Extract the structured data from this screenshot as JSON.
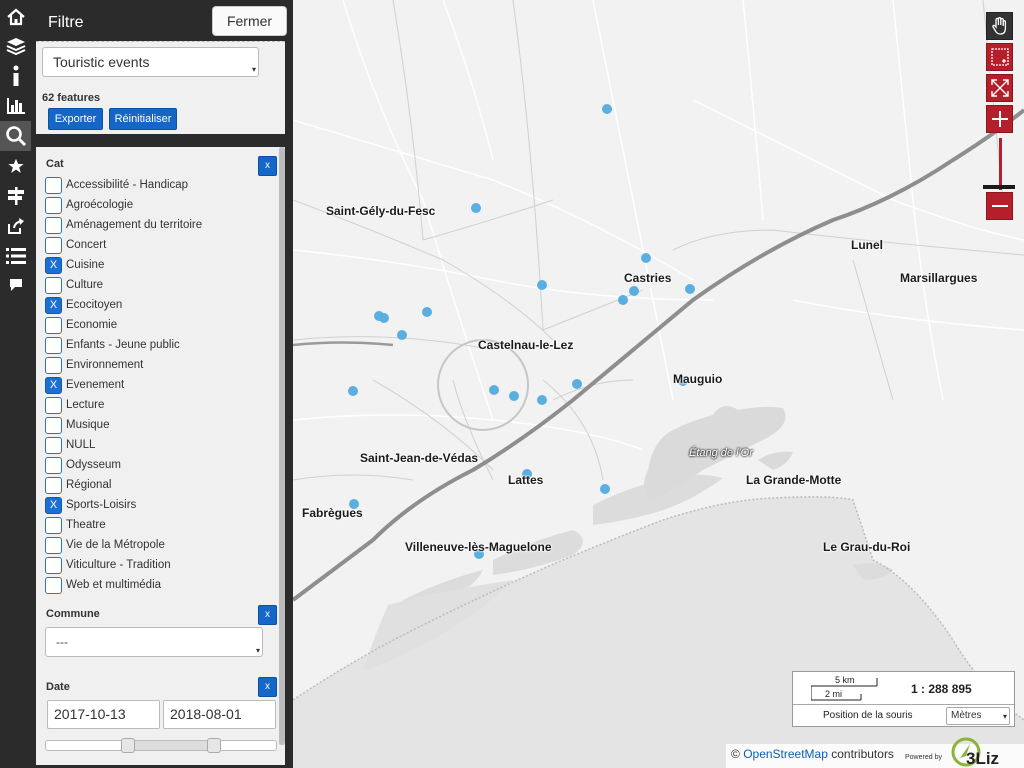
{
  "panel": {
    "title": "Filtre",
    "close_label": "Fermer",
    "layer_select": "Touristic events",
    "features_count": "62 features",
    "export_label": "Exporter",
    "reset_label": "Réinitialiser"
  },
  "cat": {
    "title": "Cat",
    "clear_label": "x",
    "items": [
      {
        "label": "Accessibilité - Handicap",
        "checked": false
      },
      {
        "label": "Agroécologie",
        "checked": false
      },
      {
        "label": "Aménagement du territoire",
        "checked": false
      },
      {
        "label": "Concert",
        "checked": false
      },
      {
        "label": "Cuisine",
        "checked": true
      },
      {
        "label": "Culture",
        "checked": false
      },
      {
        "label": "Ecocitoyen",
        "checked": true
      },
      {
        "label": "Economie",
        "checked": false
      },
      {
        "label": "Enfants - Jeune public",
        "checked": false
      },
      {
        "label": "Environnement",
        "checked": false
      },
      {
        "label": "Evenement",
        "checked": true
      },
      {
        "label": "Lecture",
        "checked": false
      },
      {
        "label": "Musique",
        "checked": false
      },
      {
        "label": "NULL",
        "checked": false
      },
      {
        "label": "Odysseum",
        "checked": false
      },
      {
        "label": "Régional",
        "checked": false
      },
      {
        "label": "Sports-Loisirs",
        "checked": true
      },
      {
        "label": "Theatre",
        "checked": false
      },
      {
        "label": "Vie de la Métropole",
        "checked": false
      },
      {
        "label": "Viticulture - Tradition",
        "checked": false
      },
      {
        "label": "Web et multimédia",
        "checked": false
      }
    ],
    "check_mark": "X"
  },
  "commune": {
    "title": "Commune",
    "clear_label": "x",
    "value": "---"
  },
  "date": {
    "title": "Date",
    "clear_label": "x",
    "from": "2017-10-13",
    "to": "2018-08-01"
  },
  "map": {
    "places": [
      "Saint-Gély-du-Fesc",
      "Lunel",
      "Castries",
      "Marsillargues",
      "Castelnau-le-Lez",
      "Mauguio",
      "Étang de l'Or",
      "Saint-Jean-de-Védas",
      "Lattes",
      "La Grande-Motte",
      "Fabrègues",
      "Villeneuve-lès-Maguelone",
      "Le Grau-du-Roi"
    ],
    "point_color": "#5aaee0"
  },
  "scale": {
    "km": "5 km",
    "mi": "2 mi",
    "ratio": "1 : 288 895",
    "mouse_label": "Position de la souris",
    "unit": "Mètres"
  },
  "attribution": {
    "osm": "OpenStreetMap",
    "contributors": " contributors",
    "powered": "Powered by",
    "logo_text": "3Liz"
  },
  "colors": {
    "sidebar": "#2b2b2b",
    "button_blue": "#1467c8",
    "control_red": "#b51f2c",
    "sea": "#e4e4e4"
  }
}
